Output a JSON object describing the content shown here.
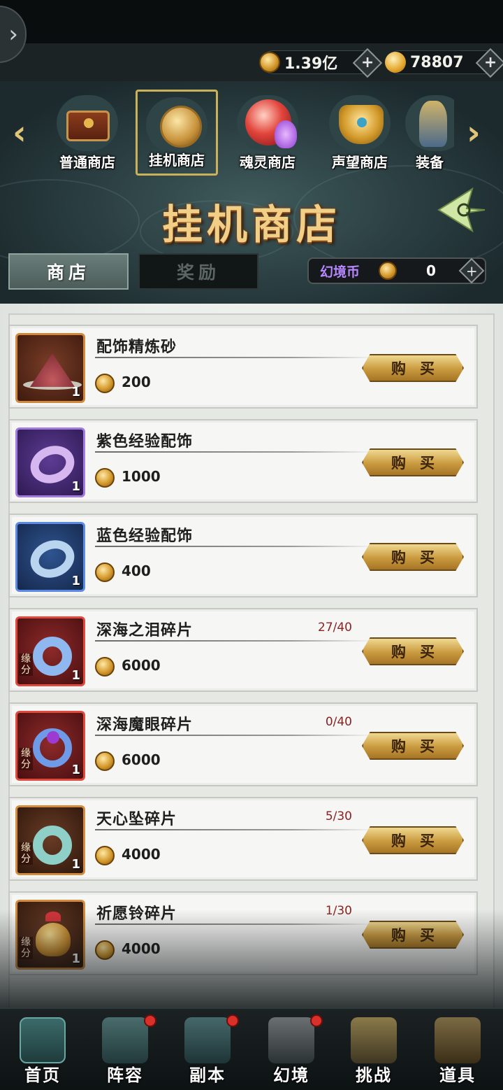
{
  "currencies": [
    {
      "icon": "gold-coin-icon",
      "value": "1.39亿"
    },
    {
      "icon": "gold-ingot-icon",
      "value": "78807"
    }
  ],
  "shop_tabs": [
    {
      "label": "普通商店",
      "icon": "treasure-chest-icon",
      "active": false
    },
    {
      "label": "挂机商店",
      "icon": "timer-coin-icon",
      "active": true
    },
    {
      "label": "魂灵商店",
      "icon": "soul-orb-icon",
      "active": false
    },
    {
      "label": "声望商店",
      "icon": "crown-icon",
      "active": false
    },
    {
      "label": "装备",
      "icon": "armor-icon",
      "active": false
    }
  ],
  "title": "挂机商店",
  "sub_tabs": [
    {
      "label": "商店",
      "active": true
    },
    {
      "label": "奖励",
      "active": false
    }
  ],
  "illusion_currency": {
    "name": "幻境币",
    "value": "0"
  },
  "items": [
    {
      "name": "配饰精炼砂",
      "price": "200",
      "qty": "1",
      "count": "",
      "tag": "",
      "frame": "orange",
      "icon": "refining-sand-icon",
      "buy": "购买"
    },
    {
      "name": "紫色经验配饰",
      "price": "1000",
      "qty": "1",
      "count": "",
      "tag": "",
      "frame": "purple",
      "icon": "purple-ring-icon",
      "buy": "购买"
    },
    {
      "name": "蓝色经验配饰",
      "price": "400",
      "qty": "1",
      "count": "",
      "tag": "",
      "frame": "blue",
      "icon": "blue-ring-icon",
      "buy": "购买"
    },
    {
      "name": "深海之泪碎片",
      "price": "6000",
      "qty": "1",
      "count": "27/40",
      "tag": "缘分",
      "frame": "red",
      "icon": "jade-pendant-icon",
      "buy": "购买"
    },
    {
      "name": "深海魔眼碎片",
      "price": "6000",
      "qty": "1",
      "count": "0/40",
      "tag": "缘分",
      "frame": "red",
      "icon": "magic-eye-ring-icon",
      "buy": "购买"
    },
    {
      "name": "天心坠碎片",
      "price": "4000",
      "qty": "1",
      "count": "5/30",
      "tag": "缘分",
      "frame": "brown",
      "icon": "jade-disc-pendant-icon",
      "buy": "购买"
    },
    {
      "name": "祈愿铃碎片",
      "price": "4000",
      "qty": "1",
      "count": "1/30",
      "tag": "缘分",
      "frame": "brown",
      "icon": "golden-bell-icon",
      "buy": "购买"
    }
  ],
  "bottom_nav": [
    {
      "label": "首页",
      "icon": "home-pavilion-icon",
      "badge": false
    },
    {
      "label": "阵容",
      "icon": "lineup-book-icon",
      "badge": true
    },
    {
      "label": "副本",
      "icon": "sword-dungeon-icon",
      "badge": true
    },
    {
      "label": "幻境",
      "icon": "crossed-swords-icon",
      "badge": true
    },
    {
      "label": "挑战",
      "icon": "scroll-map-icon",
      "badge": false
    },
    {
      "label": "道具",
      "icon": "item-bag-icon",
      "badge": false
    }
  ],
  "colors": {
    "accent_gold": "#f2cf86",
    "count_red": "#8a2222",
    "badge_red": "#d9302a",
    "illusion_purple": "#b687ff"
  }
}
